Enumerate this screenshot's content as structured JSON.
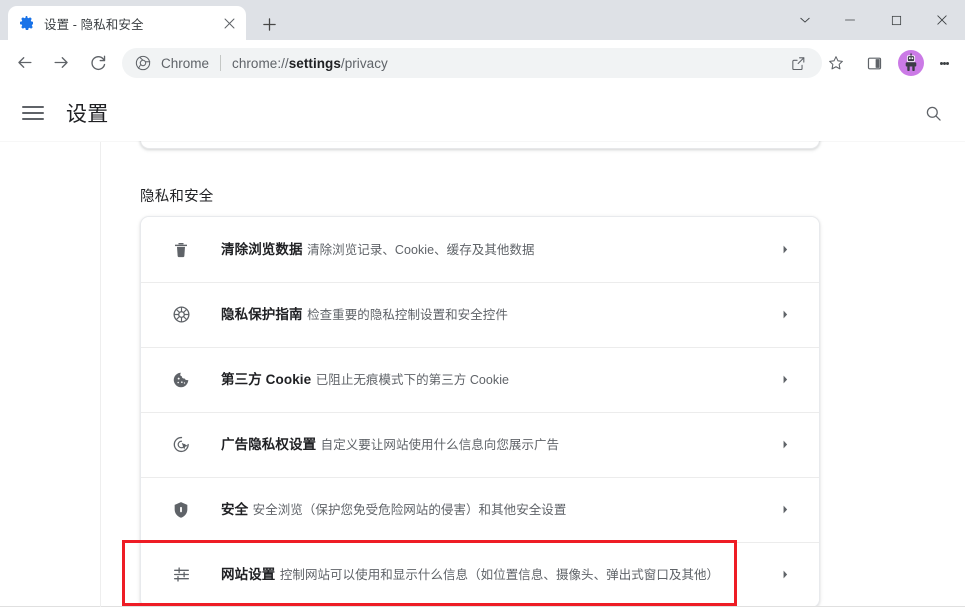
{
  "window": {
    "controls": [
      {
        "name": "chevron-down",
        "glyph": "⌄"
      },
      {
        "name": "minimize",
        "glyph": "–"
      },
      {
        "name": "maximize",
        "glyph": "□"
      },
      {
        "name": "close",
        "glyph": "✕"
      }
    ]
  },
  "tab": {
    "title": "设置 - 隐私和安全",
    "favicon": "gear-icon",
    "close_label": "✕",
    "new_tab_label": "+"
  },
  "toolbar": {
    "back_label": "←",
    "forward_label": "→",
    "reload_label": "⟳",
    "omnibox": {
      "scheme_label": "Chrome",
      "url_prefix": "chrome://",
      "url_bold": "settings",
      "url_suffix": "/privacy",
      "full_url": "chrome://settings/privacy"
    },
    "actions": [
      "share-icon",
      "bookmark-star-icon",
      "side-panel-icon"
    ],
    "avatar_color": "#cb7ae6",
    "menu_label": "⋮"
  },
  "settings": {
    "menu_label": "主菜单",
    "title": "设置",
    "search_label": "搜索设置",
    "section": {
      "heading": "隐私和安全",
      "rows": [
        {
          "icon": "trash-icon",
          "title": "清除浏览数据",
          "subtitle": "清除浏览记录、Cookie、缓存及其他数据",
          "chevron": "▸"
        },
        {
          "icon": "privacy-guide-icon",
          "title": "隐私保护指南",
          "subtitle": "检查重要的隐私控制设置和安全控件",
          "chevron": "▸"
        },
        {
          "icon": "cookie-icon",
          "title": "第三方 Cookie",
          "subtitle": "已阻止无痕模式下的第三方 Cookie",
          "chevron": "▸"
        },
        {
          "icon": "ad-privacy-icon",
          "title": "广告隐私权设置",
          "subtitle": "自定义要让网站使用什么信息向您展示广告",
          "chevron": "▸"
        },
        {
          "icon": "shield-icon",
          "title": "安全",
          "subtitle": "安全浏览（保护您免受危险网站的侵害）和其他安全设置",
          "chevron": "▸"
        },
        {
          "icon": "sliders-icon",
          "title": "网站设置",
          "subtitle": "控制网站可以使用和显示什么信息（如位置信息、摄像头、弹出式窗口及其他）",
          "chevron": "▸"
        }
      ]
    }
  },
  "annotation": {
    "color": "#ee1c25",
    "target_row_index": 5
  }
}
